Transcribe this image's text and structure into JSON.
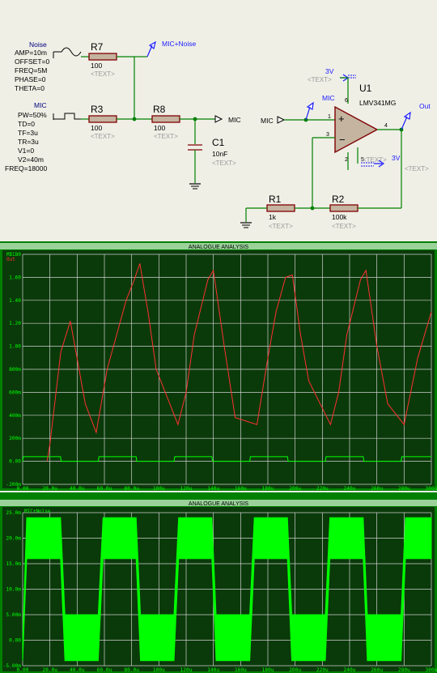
{
  "schematic": {
    "generators": [
      {
        "name": "Noise",
        "params": [
          "AMP=10m",
          "OFFSET=0",
          "FREQ=5M",
          "PHASE=0",
          "THETA=0"
        ]
      },
      {
        "name": "MIC",
        "params": [
          "PW=50%",
          "TD=0",
          "TF=3u",
          "TR=3u",
          "V1=0",
          "V2=40m",
          "FREQ=18000"
        ]
      }
    ],
    "components": {
      "R7": {
        "ref": "R7",
        "value": "100",
        "text": "<TEXT>"
      },
      "R3": {
        "ref": "R3",
        "value": "100",
        "text": "<TEXT>"
      },
      "R8": {
        "ref": "R8",
        "value": "100",
        "text": "<TEXT>"
      },
      "C1": {
        "ref": "C1",
        "value": "10nF",
        "text": "<TEXT>"
      },
      "U1": {
        "ref": "U1",
        "value": "LMV341MG",
        "text": "<TEXT>"
      },
      "R1": {
        "ref": "R1",
        "value": "1k",
        "text": "<TEXT>"
      },
      "R2": {
        "ref": "R2",
        "value": "100k",
        "text": "<TEXT>"
      }
    },
    "probes": {
      "mic_noise": "MIC+Noise",
      "mic_probe": "MIC",
      "out": "Out",
      "v_top": "3V",
      "v_bottom": "3V"
    },
    "net_labels": {
      "mic_out": "MIC",
      "mic_in": "MIC"
    },
    "pins": {
      "p1": "1",
      "p3": "3",
      "p4": "4",
      "p5": "5",
      "p6": "6",
      "p2": "2"
    },
    "top_text": "<TEXT>"
  },
  "colors": {
    "wire": "#008000",
    "component_outline": "#800000",
    "probe": "#1a1aff",
    "graph_bg": "#003800",
    "grid": "#d8d8d8",
    "trace_mic": "#00ff00",
    "trace_out": "#cc2222",
    "frame": "#008000"
  },
  "graphs": [
    {
      "title": "ANALOGUE ANALYSIS",
      "traces": [
        {
          "name": "MIC",
          "color": "#00ff00"
        },
        {
          "name": "Out",
          "color": "#ff3030"
        }
      ],
      "y_ticks": [
        "1.80",
        "1.60",
        "1.40",
        "1.20",
        "1.00",
        "800m",
        "600m",
        "400m",
        "200m",
        "0.00",
        "-200m"
      ],
      "x_ticks": [
        "0.00",
        "20.0u",
        "40.0u",
        "60.0u",
        "80.0u",
        "100u",
        "120u",
        "140u",
        "160u",
        "180u",
        "200u",
        "220u",
        "240u",
        "260u",
        "280u",
        "300u"
      ]
    },
    {
      "title": "ANALOGUE ANALYSIS",
      "traces": [
        {
          "name": "MIC+Noise",
          "color": "#00ff00"
        }
      ],
      "y_ticks": [
        "25.0m",
        "20.0m",
        "15.0m",
        "10.0m",
        "5.00m",
        "0.00",
        "-5.00m"
      ],
      "x_ticks": [
        "0.00",
        "20.0u",
        "40.0u",
        "60.0u",
        "80.0u",
        "100u",
        "120u",
        "140u",
        "160u",
        "180u",
        "200u",
        "220u",
        "240u",
        "260u",
        "280u",
        "300u"
      ]
    }
  ],
  "chart_data": [
    {
      "type": "line",
      "title": "ANALOGUE ANALYSIS",
      "xlabel": "",
      "ylabel": "",
      "xlim": [
        0,
        300
      ],
      "ylim": [
        -0.2,
        1.8
      ],
      "grid": true,
      "legend": "top-left",
      "series": [
        {
          "name": "MIC",
          "x": [
            0,
            0.5,
            27.8,
            28.3,
            55.5,
            56,
            83.3,
            83.8,
            111.1,
            111.6,
            138.9,
            139.4,
            166.7,
            167.2,
            194.4,
            194.9,
            222.2,
            222.7,
            250,
            250.5,
            277.8,
            278.3,
            300
          ],
          "y": [
            0,
            0.04,
            0.04,
            0,
            0,
            0.04,
            0.04,
            0,
            0,
            0.04,
            0.04,
            0,
            0,
            0.04,
            0.04,
            0,
            0,
            0.04,
            0.04,
            0,
            0,
            0.04,
            0.04
          ]
        },
        {
          "name": "Out",
          "x": [
            18,
            20,
            24,
            28,
            35,
            46,
            54,
            62,
            76,
            82,
            86,
            92,
            98,
            114,
            120,
            126,
            136,
            140,
            148,
            156,
            172,
            180,
            186,
            193,
            198,
            204,
            210,
            226,
            232,
            238,
            248,
            252,
            260,
            268,
            280,
            290,
            300
          ],
          "y": [
            0,
            0.15,
            0.55,
            0.95,
            1.22,
            0.5,
            0.25,
            0.8,
            1.4,
            1.58,
            1.72,
            1.3,
            0.8,
            0.32,
            0.6,
            1.1,
            1.58,
            1.66,
            1.0,
            0.38,
            0.32,
            0.9,
            1.3,
            1.6,
            1.62,
            1.1,
            0.7,
            0.32,
            0.6,
            1.1,
            1.58,
            1.66,
            1.0,
            0.5,
            0.32,
            0.9,
            1.3
          ]
        }
      ]
    },
    {
      "type": "area",
      "title": "ANALOGUE ANALYSIS",
      "xlabel": "",
      "ylabel": "",
      "xlim": [
        0,
        300
      ],
      "ylim": [
        -0.005,
        0.025
      ],
      "grid": true,
      "legend": "top-left",
      "series": [
        {
          "name": "MIC+Noise",
          "x": [
            0,
            3,
            27.8,
            31,
            55.5,
            59,
            83.3,
            86.5,
            111.1,
            114.5,
            138.9,
            142,
            166.7,
            170,
            194.4,
            197.5,
            222.2,
            225.5,
            250,
            253,
            277.8,
            281,
            300
          ],
          "y_high": [
            0,
            0.024,
            0.024,
            0.005,
            0.005,
            0.024,
            0.024,
            0.005,
            0.005,
            0.024,
            0.024,
            0.005,
            0.005,
            0.024,
            0.024,
            0.005,
            0.005,
            0.024,
            0.024,
            0.005,
            0.005,
            0.024,
            0.024
          ],
          "y_low": [
            -0.004,
            0.016,
            0.016,
            -0.004,
            -0.004,
            0.016,
            0.016,
            -0.004,
            -0.004,
            0.016,
            0.016,
            -0.004,
            -0.004,
            0.016,
            0.016,
            -0.004,
            -0.004,
            0.016,
            0.016,
            -0.004,
            -0.004,
            0.016,
            0.016
          ]
        }
      ]
    }
  ]
}
